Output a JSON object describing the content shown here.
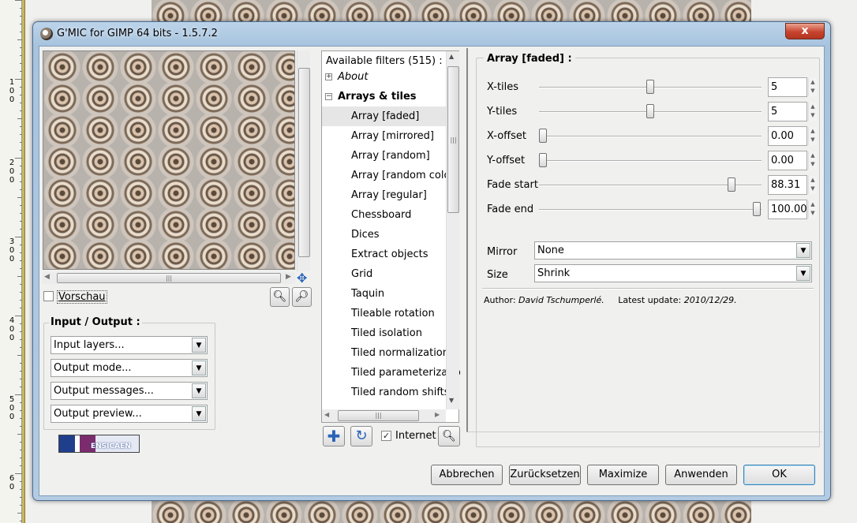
{
  "window": {
    "title": "G'MIC for GIMP 64 bits - 1.5.7.2",
    "close_label": "x"
  },
  "ruler": {
    "marks": [
      "1",
      "0",
      "0",
      "2",
      "0",
      "0",
      "3",
      "0",
      "0",
      "4",
      "0",
      "0",
      "5",
      "0",
      "0",
      "6",
      "0"
    ]
  },
  "preview": {
    "checkbox_label": "Vorschau",
    "checked": false,
    "hscroll_grip": "|||"
  },
  "io": {
    "title": "Input / Output :",
    "combos": [
      "Input layers...",
      "Output mode...",
      "Output messages...",
      "Output preview..."
    ]
  },
  "logo": {
    "text": "ENSICAEN"
  },
  "filters": {
    "header": "Available filters (515) :",
    "categories": [
      {
        "label": "About",
        "expanded": false
      },
      {
        "label": "Arrays & tiles",
        "expanded": true
      }
    ],
    "items": [
      "Array [faded]",
      "Array [mirrored]",
      "Array [random]",
      "Array [random color",
      "Array [regular]",
      "Chessboard",
      "Dices",
      "Extract objects",
      "Grid",
      "Taquin",
      "Tileable rotation",
      "Tiled isolation",
      "Tiled normalization",
      "Tiled parameterizatio",
      "Tiled random shifts"
    ],
    "selected_index": 0,
    "internet_label": "Internet",
    "internet_checked": true,
    "vscroll_grip": "|||",
    "hscroll_grip": "|||"
  },
  "params": {
    "title": "Array [faded] :",
    "sliders": [
      {
        "label": "X-tiles",
        "value": "5",
        "fraction": 0.5
      },
      {
        "label": "Y-tiles",
        "value": "5",
        "fraction": 0.5
      },
      {
        "label": "X-offset",
        "value": "0.00",
        "fraction": 0.0
      },
      {
        "label": "Y-offset",
        "value": "0.00",
        "fraction": 0.0
      },
      {
        "label": "Fade start",
        "value": "88.31",
        "fraction": 0.8831
      },
      {
        "label": "Fade end",
        "value": "100.00",
        "fraction": 1.0
      }
    ],
    "mirror": {
      "label": "Mirror",
      "value": "None"
    },
    "size": {
      "label": "Size",
      "value": "Shrink"
    },
    "author_label": "Author:",
    "author": "David Tschumperlé.",
    "update_label": "Latest update:",
    "update": "2010/12/29."
  },
  "buttons": {
    "cancel": "Abbrechen",
    "reset": "Zurücksetzen",
    "maximize": "Maximize",
    "apply": "Anwenden",
    "ok": "OK"
  }
}
